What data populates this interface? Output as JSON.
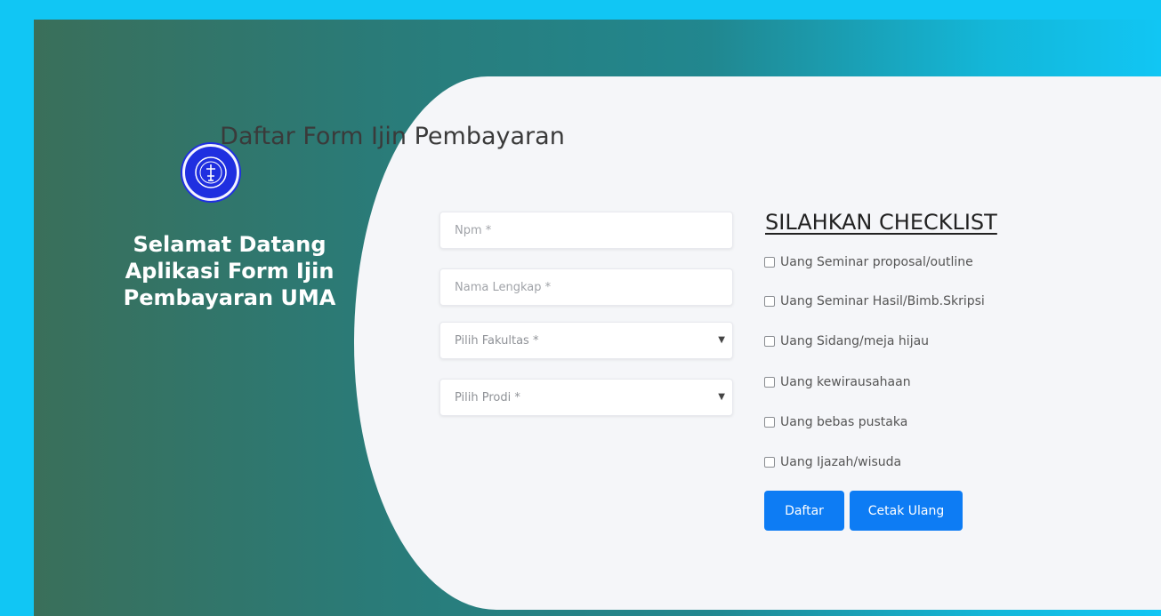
{
  "welcome": {
    "line1": "Selamat Datang",
    "line2": "Aplikasi Form Ijin",
    "line3": "Pembayaran UMA"
  },
  "form": {
    "title": "Daftar Form Ijin Pembayaran",
    "npm_placeholder": "Npm *",
    "nama_placeholder": "Nama Lengkap *",
    "fakultas_selected": "Pilih Fakultas *",
    "prodi_selected": "Pilih Prodi *"
  },
  "checklist": {
    "title": "SILAHKAN CHECKLIST",
    "items": [
      {
        "label": "Uang Seminar proposal/outline",
        "checked": false
      },
      {
        "label": "Uang Seminar Hasil/Bimb.Skripsi",
        "checked": false
      },
      {
        "label": "Uang Sidang/meja hijau",
        "checked": false
      },
      {
        "label": "Uang kewirausahaan",
        "checked": false
      },
      {
        "label": "Uang bebas pustaka",
        "checked": false
      },
      {
        "label": "Uang Ijazah/wisuda",
        "checked": false
      }
    ]
  },
  "buttons": {
    "daftar": "Daftar",
    "cetak_ulang": "Cetak Ulang"
  },
  "colors": {
    "outer_background": "#11c6f4",
    "card_background": "#f5f6f9",
    "button_primary": "#0d7cf4",
    "logo_blue": "#1f2fe0"
  },
  "icons": {
    "logo": "university-seal-icon",
    "select_caret": "caret-down-icon"
  }
}
